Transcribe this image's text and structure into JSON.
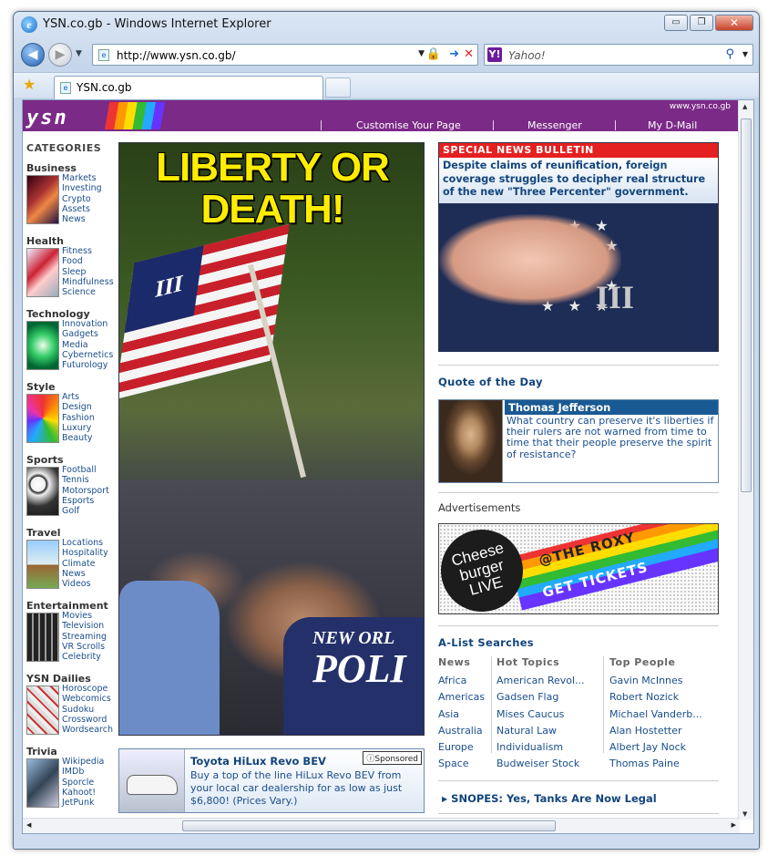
{
  "window": {
    "title": "YSN.co.gb - Windows Internet Explorer",
    "min": "▭",
    "max": "❐",
    "close": "✕"
  },
  "toolbar": {
    "url": "http://www.ysn.co.gb/",
    "search_placeholder": "Yahoo!",
    "search_logo": "Y!"
  },
  "tab": {
    "title": "YSN.co.gb"
  },
  "header": {
    "logo": "ysn",
    "domain": "www.ysn.co.gb",
    "nav": [
      "Customise Your Page",
      "Messenger",
      "My D-Mail"
    ],
    "brand_color": "#7b2a87"
  },
  "sidebar": {
    "title": "CATEGORIES",
    "categories": [
      {
        "name": "Business",
        "links": [
          "Markets",
          "Investing",
          "Crypto",
          "Assets",
          "News"
        ]
      },
      {
        "name": "Health",
        "links": [
          "Fitness",
          "Food",
          "Sleep",
          "Mindfulness",
          "Science"
        ]
      },
      {
        "name": "Technology",
        "links": [
          "Innovation",
          "Gadgets",
          "Media",
          "Cybernetics",
          "Futurology"
        ]
      },
      {
        "name": "Style",
        "links": [
          "Arts",
          "Design",
          "Fashion",
          "Luxury",
          "Beauty"
        ]
      },
      {
        "name": "Sports",
        "links": [
          "Football",
          "Tennis",
          "Motorsport",
          "Esports",
          "Golf"
        ]
      },
      {
        "name": "Travel",
        "links": [
          "Locations",
          "Hospitality",
          "Climate",
          "News",
          "Videos"
        ]
      },
      {
        "name": "Entertainment",
        "links": [
          "Movies",
          "Television",
          "Streaming",
          "VR Scrolls",
          "Celebrity"
        ]
      },
      {
        "name": "YSN Dailies",
        "links": [
          "Horoscope",
          "Webcomics",
          "Sudoku",
          "Crossword",
          "Wordsearch"
        ]
      },
      {
        "name": "Trivia",
        "links": [
          "Wikipedia",
          "IMDb",
          "Sporcle",
          "Kahoot!",
          "JetPunk"
        ]
      }
    ]
  },
  "hero": {
    "headline_line1": "LIBERTY OR",
    "headline_line2": "DEATH!",
    "flag_mark": "III",
    "police_line1": "NEW ORL",
    "police_line2": "POLI"
  },
  "sponsored": {
    "title": "Toyota HiLux Revo BEV",
    "badge": "ⓘSponsored",
    "body": "Buy a top of the line HiLux Revo BEV from your local car dealership for as low as just $6,800! (Prices Vary.)"
  },
  "bulletin": {
    "header": "SPECIAL NEWS BULLETIN",
    "headline": "Despite claims of reunification, foreign coverage struggles to decipher real structure of the new \"Three Percenter\" government.",
    "mark": "III"
  },
  "quote": {
    "section": "Quote of the Day",
    "author": "Thomas Jefferson",
    "text": "What country can preserve it's liberties if their rulers are not warned from time to time that their people preserve the spirit of resistance?"
  },
  "ads": {
    "label": "Advertisements",
    "bubble": "Cheese burger LIVE",
    "venue": "@THE ROXY",
    "cta": "GET TICKETS"
  },
  "alist": {
    "title": "A-List Searches",
    "columns": [
      {
        "header": "News",
        "items": [
          "Africa",
          "Americas",
          "Asia",
          "Australia",
          "Europe",
          "Space"
        ]
      },
      {
        "header": "Hot Topics",
        "items": [
          "American Revol...",
          "Gadsen Flag",
          "Mises Caucus",
          "Natural Law",
          "Individualism",
          "Budweiser Stock"
        ]
      },
      {
        "header": "Top People",
        "items": [
          "Gavin McInnes",
          "Robert Nozick",
          "Michael Vanderb...",
          "Alan Hostetter",
          "Albert Jay Nock",
          "Thomas Paine"
        ]
      }
    ]
  },
  "snopes": "SNOPES: Yes, Tanks Are Now Legal"
}
